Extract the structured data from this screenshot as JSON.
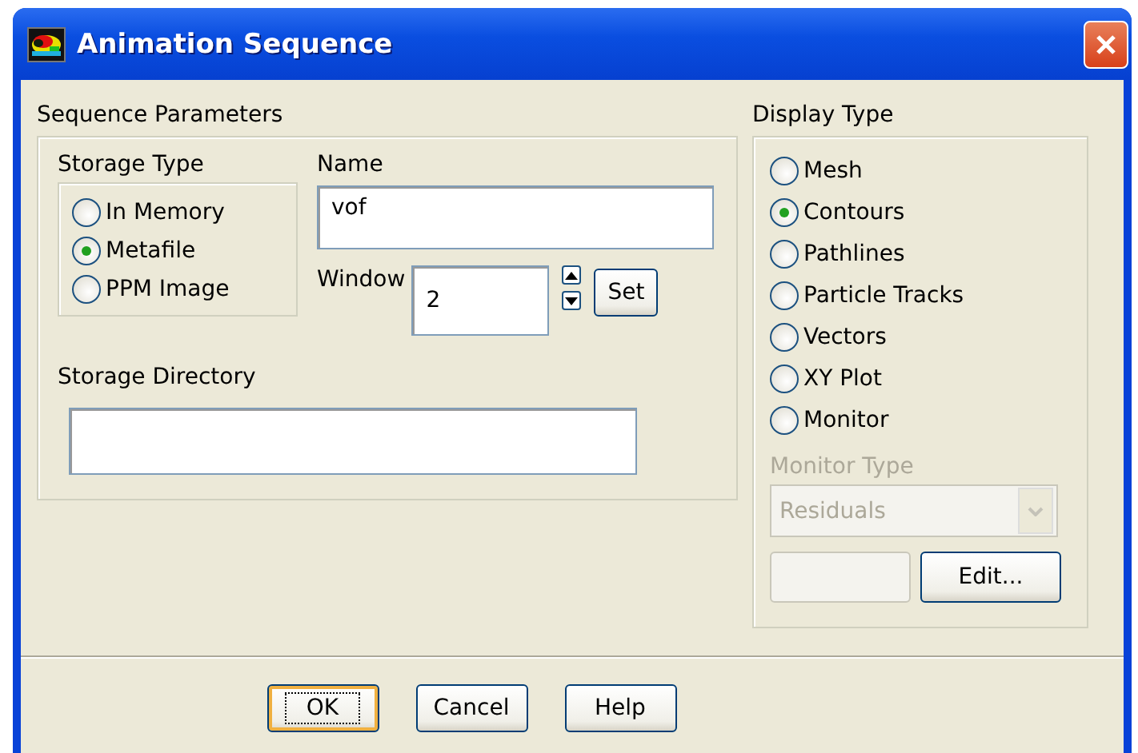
{
  "window": {
    "title": "Animation Sequence"
  },
  "sequence_parameters": {
    "title": "Sequence Parameters",
    "storage_type": {
      "title": "Storage Type",
      "options": [
        {
          "label": "In Memory",
          "selected": false
        },
        {
          "label": "Metafile",
          "selected": true
        },
        {
          "label": "PPM Image",
          "selected": false
        }
      ]
    },
    "name": {
      "label": "Name",
      "value": "vof"
    },
    "window_field": {
      "label": "Window",
      "value": "2"
    },
    "set_button": "Set",
    "storage_directory": {
      "label": "Storage Directory"
    }
  },
  "display_type": {
    "title": "Display Type",
    "options": [
      {
        "label": "Mesh",
        "selected": false
      },
      {
        "label": "Contours",
        "selected": true
      },
      {
        "label": "Pathlines",
        "selected": false
      },
      {
        "label": "Particle Tracks",
        "selected": false
      },
      {
        "label": "Vectors",
        "selected": false
      },
      {
        "label": "XY Plot",
        "selected": false
      },
      {
        "label": "Monitor",
        "selected": false
      }
    ],
    "monitor_type": {
      "label": "Monitor Type",
      "value": "Residuals",
      "disabled": true
    },
    "edit_button": "Edit..."
  },
  "buttons": [
    {
      "label": "OK",
      "focused": true
    },
    {
      "label": "Cancel",
      "focused": false
    },
    {
      "label": "Help",
      "focused": false
    }
  ]
}
